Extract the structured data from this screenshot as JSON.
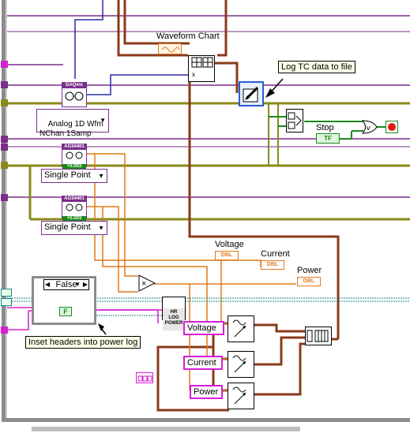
{
  "diagram": {
    "chart_label": "Waveform Chart",
    "log_tc_comment": "Log TC data to file",
    "daqmx_icon_text": "DAQmx",
    "daqmx_read_mode": "Analog 1D Wfm\nNChan 1Samp",
    "ag_icon_text": "AG34401",
    "ag_readout": "+0.003",
    "single_point_1": "Single Point",
    "single_point_2": "Single Point",
    "stop_label": "Stop",
    "stop_control": "TF",
    "voltage_label": "Voltage",
    "current_label": "Current",
    "power_label": "Power",
    "dbl_tag": "DBL",
    "case_selector": "False",
    "false_const": "F",
    "hr_log_power": "HR\nLOG\nPOWER",
    "voltage_bundle": "Voltage",
    "current_bundle": "Current",
    "power_bundle": "Power",
    "inset_comment": "Inset headers into power log"
  },
  "colors": {
    "orange_wire": "#e07a1a",
    "olive_wire": "#8a8a1a",
    "pink_wire": "#d61ed6",
    "purple_wire": "#7a2d8a",
    "brown_wire": "#8a3a1a",
    "teal_wire": "#1a8a8a",
    "blue_wire": "#2a2aa8",
    "green_wire": "#1a8a1a"
  }
}
